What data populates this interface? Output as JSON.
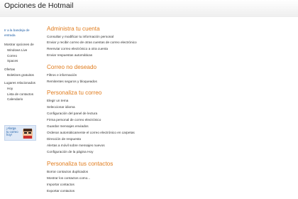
{
  "header": {
    "title": "Opciones de Hotmail"
  },
  "sidebar": {
    "back_link": "Ir a la bandeja de entrada",
    "groups": [
      {
        "label": "Mostrar opciones de",
        "items": [
          "Windows Live",
          "Correo",
          "Spaces"
        ]
      },
      {
        "label": "Ofertas",
        "items": [
          "Boletines gratuitos"
        ]
      },
      {
        "label": "Lugares relacionados",
        "items": [
          "Hoy",
          "Lista de contactos",
          "Calendario"
        ]
      }
    ],
    "ad_text": "¡Alarga tu correo hoy!"
  },
  "sections": [
    {
      "title": "Administra tu cuenta",
      "items": [
        "Consultar y modificar tu información personal",
        "Enviar y recibir correo de otras cuentas de correo electrónico",
        "Reenviar correo electrónico a otra cuenta",
        "Enviar respuestas automáticas"
      ]
    },
    {
      "title": "Correo no deseado",
      "items": [
        "Filtros e información",
        "Remitentes seguros y bloqueados"
      ]
    },
    {
      "title": "Personaliza tu correo",
      "items": [
        "Elegir un tema",
        "Seleccionar idioma",
        "Configuración del panel de lectura",
        "Firma personal de correo electrónico",
        "Guardar mensajes enviados",
        "Ordenar automáticamente el correo electrónico en carpetas",
        "Dirección de respuesta",
        "Alertas a móvil sobre mensajes nuevos",
        "Configuración de la página Hoy"
      ]
    },
    {
      "title": "Personaliza tus contactos",
      "items": [
        "Borrar contactos duplicados",
        "Mostrar los contactos como...",
        "Importar contactos",
        "Exportar contactos"
      ]
    }
  ]
}
